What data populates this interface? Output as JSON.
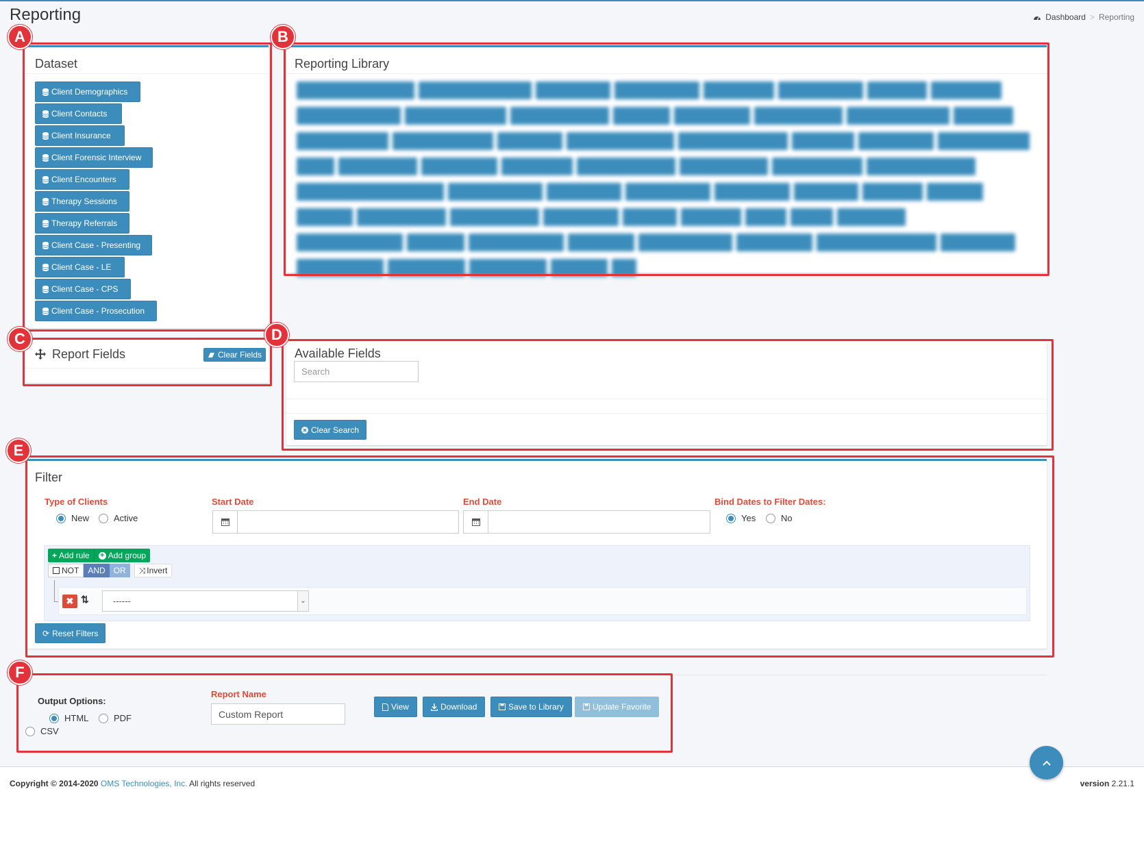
{
  "header": {
    "title": "Reporting",
    "breadcrumb": {
      "home": "Dashboard",
      "separator": ">",
      "current": "Reporting"
    }
  },
  "annotations": [
    "A",
    "B",
    "C",
    "D",
    "E",
    "F"
  ],
  "dataset": {
    "title": "Dataset",
    "items": [
      "Client Demographics",
      "Client Contacts",
      "Client Insurance",
      "Client Forensic Interview",
      "Client Encounters",
      "Therapy Sessions",
      "Therapy Referrals",
      "Client Case - Presenting",
      "Client Case - LE",
      "Client Case - CPS",
      "Client Case - Prosecution"
    ]
  },
  "library": {
    "title": "Reporting Library"
  },
  "report_fields": {
    "title": "Report Fields",
    "clear_label": "Clear Fields"
  },
  "available_fields": {
    "title": "Available Fields",
    "search_placeholder": "Search",
    "clear_search_label": "Clear Search"
  },
  "filter": {
    "title": "Filter",
    "type_label": "Type of Clients",
    "type_options": [
      "New",
      "Active"
    ],
    "type_selected": "New",
    "start_label": "Start Date",
    "end_label": "End Date",
    "bind_label": "Bind Dates to Filter Dates:",
    "bind_options": [
      "Yes",
      "No"
    ],
    "bind_selected": "Yes",
    "add_rule": "Add rule",
    "add_group": "Add group",
    "not": "NOT",
    "and": "AND",
    "or": "OR",
    "invert": "Invert",
    "rule_select": "------",
    "reset_label": "Reset Filters"
  },
  "output": {
    "label": "Output Options:",
    "options": [
      "HTML",
      "PDF",
      "CSV"
    ],
    "selected": "HTML",
    "report_name_label": "Report Name",
    "report_name_value": "Custom Report",
    "view": "View",
    "download": "Download",
    "save": "Save to Library",
    "update": "Update Favorite"
  },
  "footer": {
    "copyright": "Copyright © 2014-2020",
    "company": "OMS Technologies, Inc.",
    "rights": "All rights reserved",
    "version_label": "version",
    "version": "2.21.1"
  },
  "colors": {
    "primary": "#3c8dbc",
    "success": "#00a65a",
    "danger": "#dd4b39",
    "highlight": "#e2333a"
  }
}
